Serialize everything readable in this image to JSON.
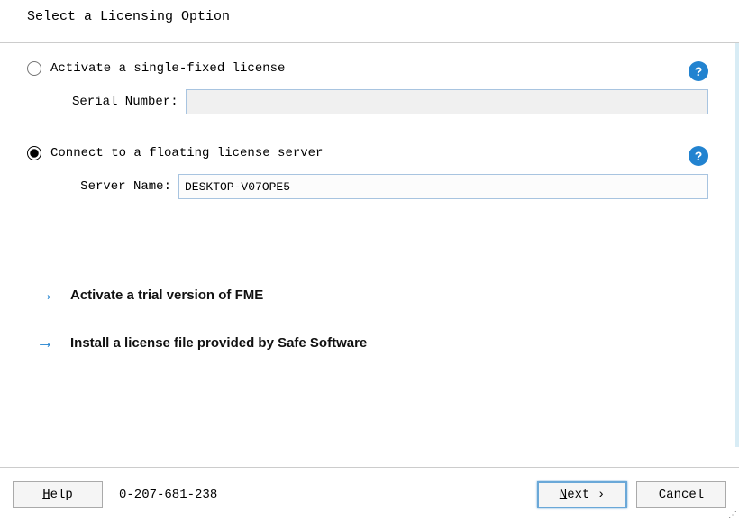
{
  "header": {
    "title": "Select a Licensing Option"
  },
  "options": {
    "single_fixed": {
      "label": "Activate a single-fixed license",
      "serial_label": "Serial Number:",
      "serial_value": "",
      "selected": false
    },
    "floating": {
      "label": "Connect to a floating license server",
      "server_label": "Server Name:",
      "server_value": "DESKTOP-V07OPE5",
      "selected": true
    }
  },
  "links": {
    "trial": "Activate a trial version of FME",
    "install_file": "Install a license file provided by Safe Software"
  },
  "footer": {
    "help": "Help",
    "code": "0-207-681-238",
    "next": "Next",
    "cancel": "Cancel"
  },
  "icons": {
    "help_glyph": "?",
    "arrow_glyph": "→",
    "next_arrow": "›"
  }
}
